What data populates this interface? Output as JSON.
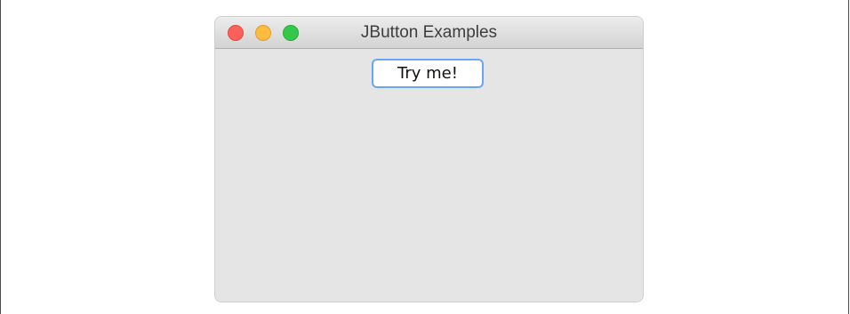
{
  "window": {
    "title": "JButton Examples"
  },
  "buttons": {
    "try_me_label": "Try me!"
  },
  "colors": {
    "close": "#fc605b",
    "minimize": "#fdbc40",
    "zoom": "#34c84a",
    "button_focus_border": "#6aa5f2",
    "content_background": "#e5e5e5"
  }
}
